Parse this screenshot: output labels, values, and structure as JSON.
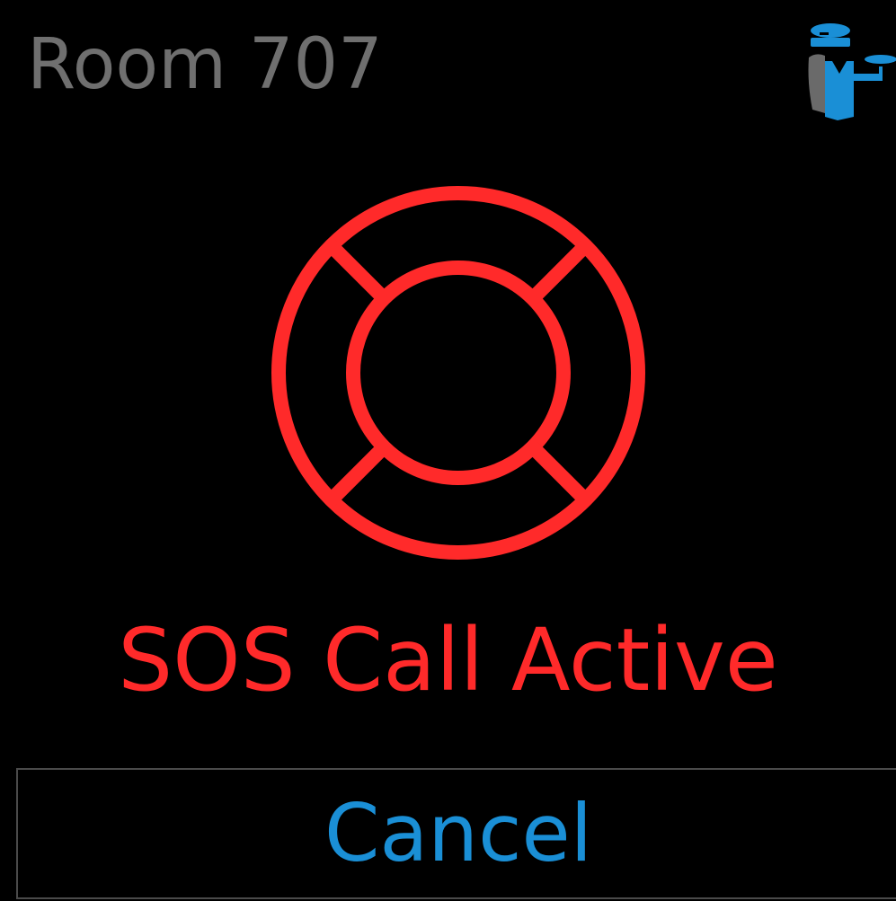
{
  "header": {
    "title": "Room 707",
    "logo_icon": "butler-icon"
  },
  "status": {
    "icon": "lifebuoy-icon",
    "text": "SOS Call Active"
  },
  "actions": {
    "cancel_label": "Cancel"
  },
  "colors": {
    "background": "#000000",
    "title": "#6f6f6f",
    "alert": "#ff2a2a",
    "accent": "#1a8fd6",
    "button_border": "#4a4a4a"
  }
}
